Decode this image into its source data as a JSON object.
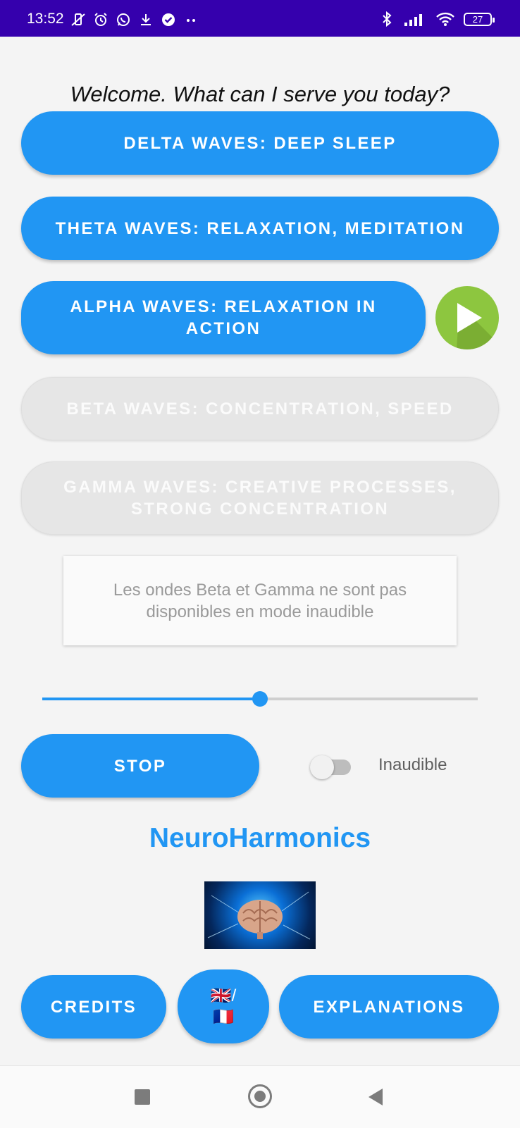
{
  "status_bar": {
    "time": "13:52",
    "left_icons": [
      "vibrate-off-icon",
      "alarm-icon",
      "whatsapp-icon",
      "download-icon",
      "check-circle-icon",
      "more-dots-icon"
    ],
    "right_icons": [
      "bluetooth-icon",
      "signal-icon",
      "wifi-icon"
    ],
    "battery": "27",
    "background": "#3500ad"
  },
  "welcome_text": "Welcome. What can I serve you today?",
  "wave_buttons": [
    {
      "label": "DELTA WAVES: DEEP SLEEP",
      "enabled": true
    },
    {
      "label": "THETA WAVES: RELAXATION, MEDITATION",
      "enabled": true
    },
    {
      "label": "ALPHA WAVES: RELAXATION IN ACTION",
      "enabled": true
    },
    {
      "label": "BETA WAVES: CONCENTRATION, SPEED",
      "enabled": false
    },
    {
      "label": "GAMMA WAVES: CREATIVE PROCESSES, STRONG CONCENTRATION",
      "enabled": false
    }
  ],
  "play_button": {
    "icon": "play-icon",
    "color": "#8dc63f"
  },
  "info_message": "Les ondes Beta et Gamma ne sont pas disponibles en mode inaudible",
  "volume_slider": {
    "value_fraction": 0.5
  },
  "stop_button": "STOP",
  "inaudible_toggle": {
    "label": "Inaudible",
    "on": false
  },
  "app_title": "NeuroHarmonics",
  "footer_buttons": {
    "credits": "CREDITS",
    "language": {
      "line1": "🇬🇧/",
      "line2": "🇫🇷"
    },
    "explanations": "EXPLANATIONS"
  },
  "colors": {
    "accent": "#2196f3",
    "disabled": "#e6e6e6",
    "background": "#f4f4f4"
  },
  "nav_bar": {
    "icons": [
      "recents-square-icon",
      "home-circle-icon",
      "back-triangle-icon"
    ]
  }
}
